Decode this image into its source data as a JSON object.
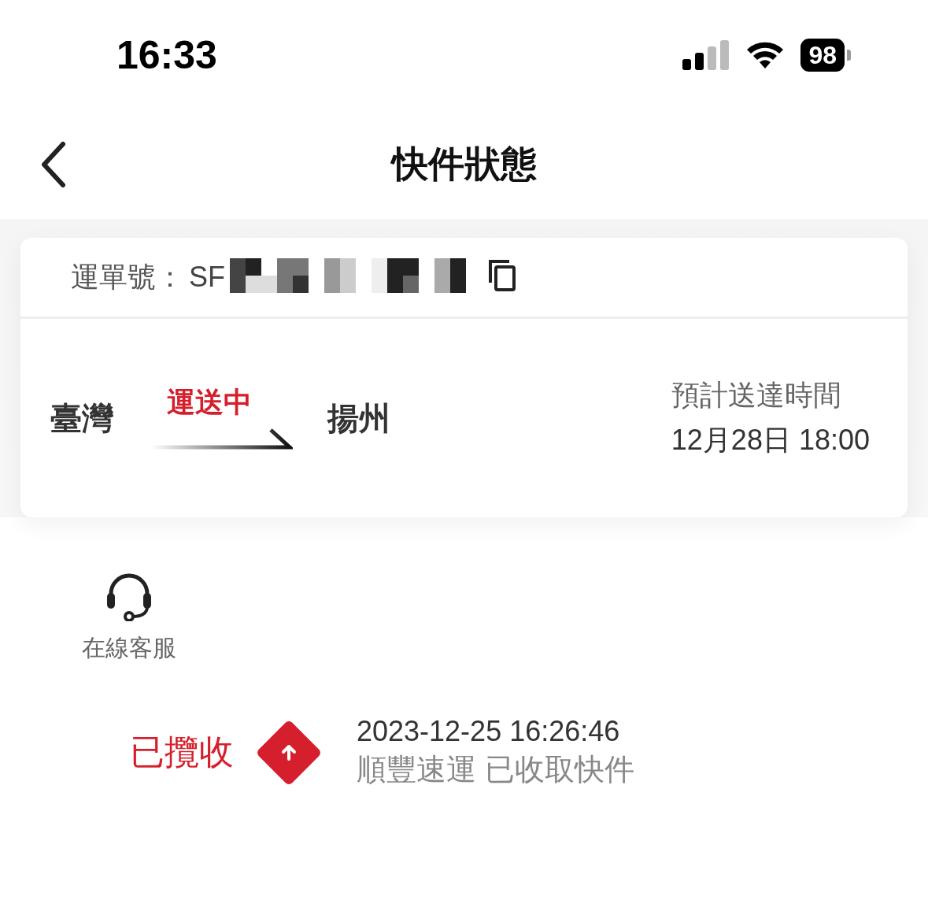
{
  "status_bar": {
    "time": "16:33",
    "battery": "98"
  },
  "nav": {
    "title": "快件狀態"
  },
  "waybill": {
    "label": "運單號：",
    "number": "SF"
  },
  "route": {
    "origin": "臺灣",
    "status": "運送中",
    "destination": "揚州",
    "eta_label": "預計送達時間",
    "eta": "12月28日 18:00"
  },
  "service": {
    "label": "在線客服"
  },
  "events": [
    {
      "status": "已攬收",
      "time": "2023-12-25 16:26:46",
      "description": "順豐速運 已收取快件"
    }
  ]
}
